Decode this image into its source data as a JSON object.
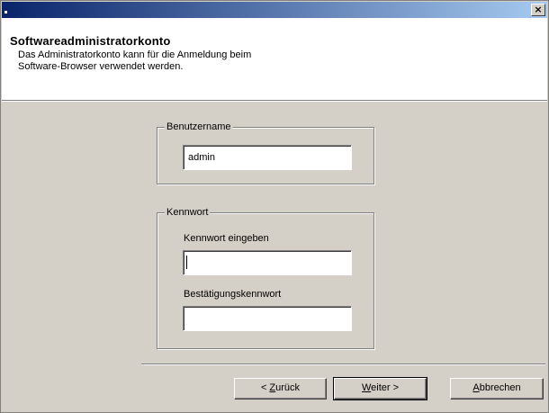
{
  "header": {
    "title": "Softwareadministratorkonto",
    "description_line1": "Das Administratorkonto kann für die Anmeldung beim",
    "description_line2": "Software-Browser verwendet werden."
  },
  "username_group": {
    "legend": "Benutzername",
    "value": "admin"
  },
  "password_group": {
    "legend": "Kennwort",
    "enter_label": "Kennwort eingeben",
    "enter_value": "",
    "confirm_label": "Bestätigungskennwort",
    "confirm_value": ""
  },
  "buttons": {
    "back_prefix": "< ",
    "back_mnemonic": "Z",
    "back_rest": "urück",
    "next_mnemonic": "W",
    "next_rest": "eiter >",
    "cancel_mnemonic": "A",
    "cancel_rest": "bbrechen"
  },
  "titlebar": {
    "close_glyph": "×"
  }
}
